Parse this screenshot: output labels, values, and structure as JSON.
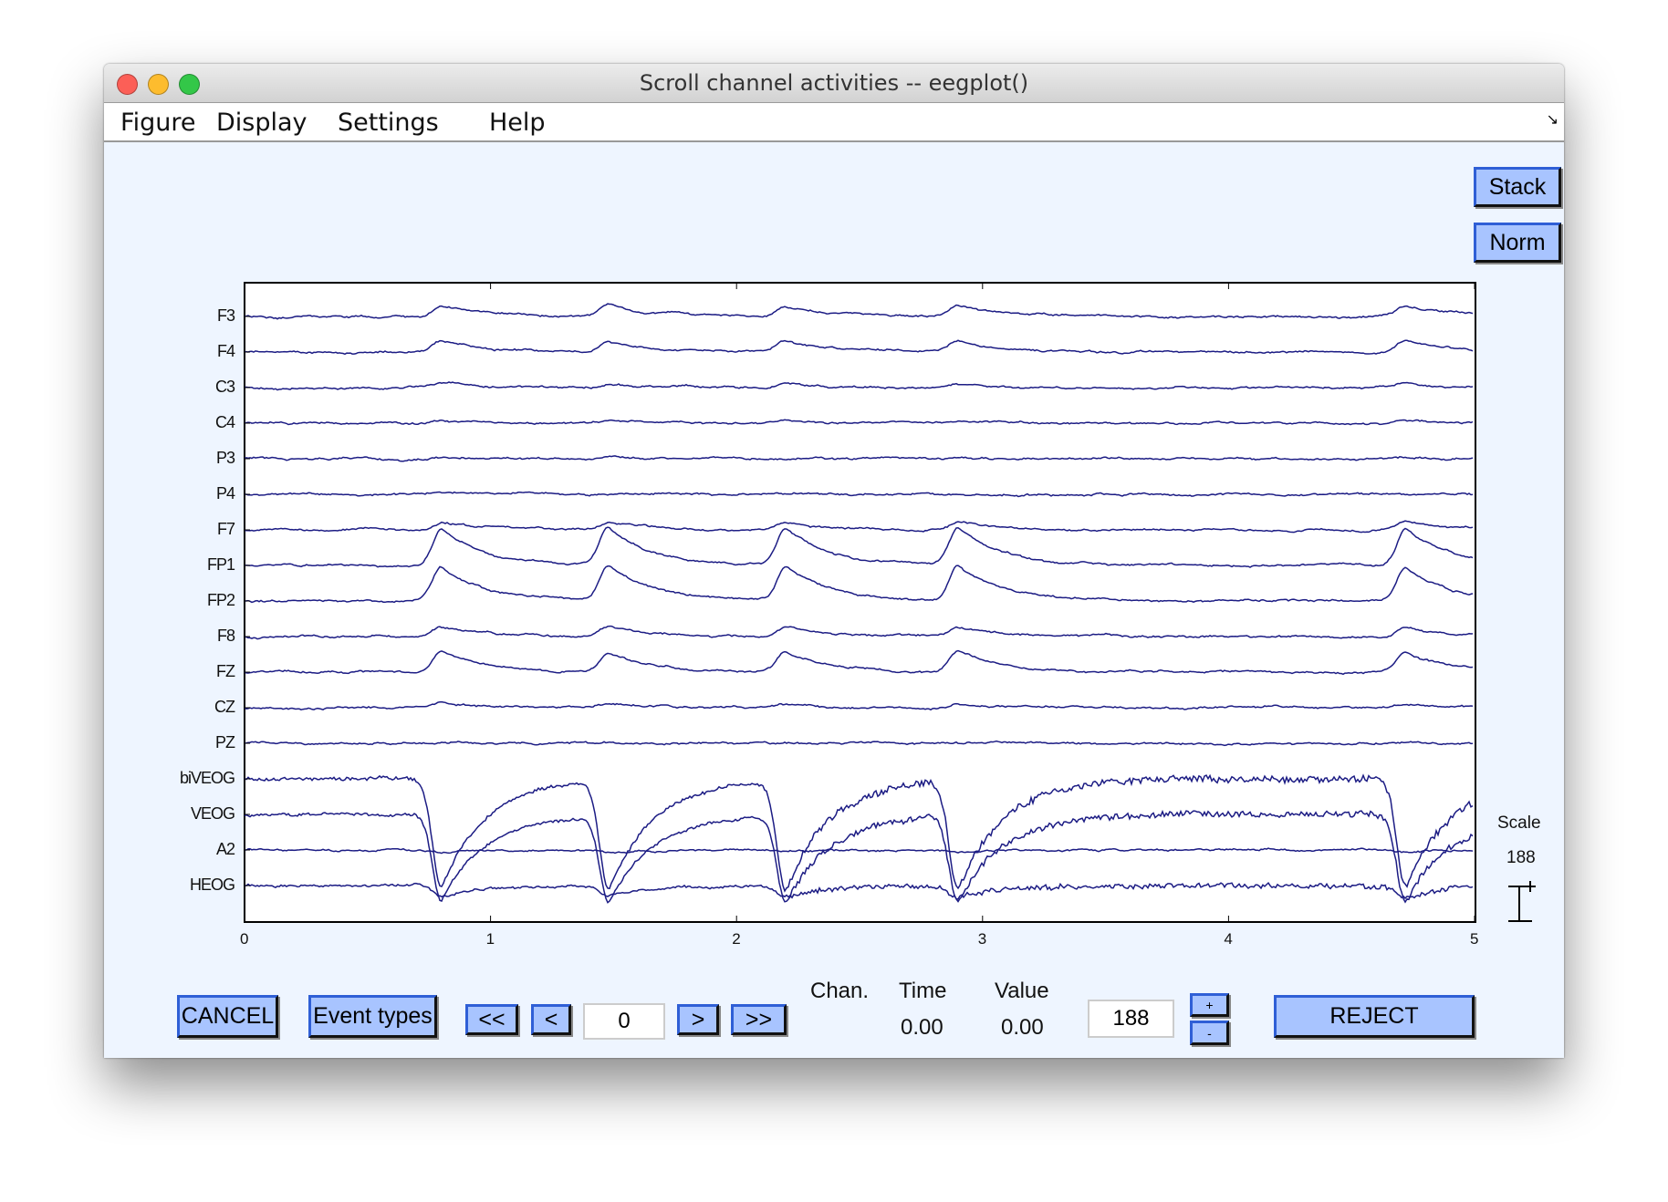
{
  "window": {
    "title": "Scroll channel activities -- eegplot()"
  },
  "menu": [
    "Figure",
    "Display",
    "Settings",
    "Help"
  ],
  "buttons": {
    "stack": "Stack",
    "norm": "Norm",
    "cancel": "CANCEL",
    "event_types": "Event types",
    "first": "<<",
    "prev": "<",
    "next": ">",
    "last": ">>",
    "plus": "+",
    "minus": "-",
    "reject": "REJECT"
  },
  "readout": {
    "chan_label": "Chan.",
    "time_label": "Time",
    "value_label": "Value",
    "time": "0.00",
    "value": "0.00"
  },
  "position_input": "0",
  "scale_input": "188",
  "scale": {
    "label": "Scale",
    "value": "188"
  },
  "colors": {
    "trace": "#1c1c84",
    "button": "#a8c4ff",
    "background": "#eef5ff"
  },
  "chart_data": {
    "type": "line",
    "channels": [
      "F3",
      "F4",
      "C3",
      "C4",
      "P3",
      "P4",
      "F7",
      "FP1",
      "FP2",
      "F8",
      "FZ",
      "CZ",
      "PZ",
      "biVEOG",
      "VEOG",
      "A2",
      "HEOG"
    ],
    "xticks": [
      "0",
      "1",
      "2",
      "3",
      "4",
      "5"
    ],
    "xlim": [
      0,
      5
    ],
    "events": [
      0.75,
      1.43,
      2.15,
      2.85,
      4.67
    ]
  }
}
